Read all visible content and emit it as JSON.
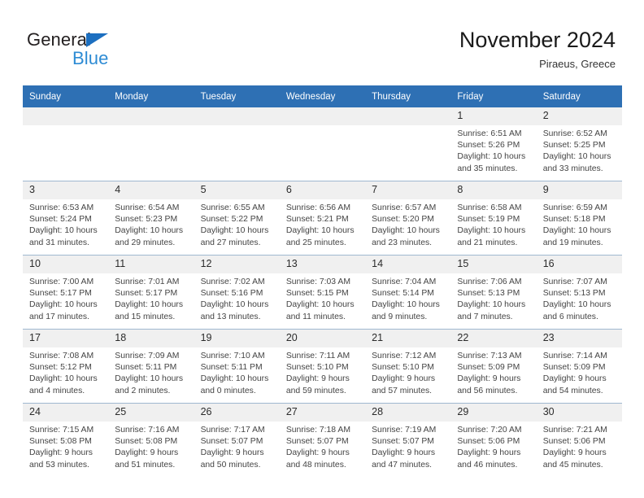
{
  "brand": {
    "name_part1": "General",
    "name_part2": "Blue",
    "triangle_icon": "triangle-icon",
    "accent_dark": "#231f20",
    "accent_blue": "#2d8bd4",
    "triangle_blue": "#1c6fc0"
  },
  "header": {
    "title": "November 2024",
    "subtitle": "Piraeus, Greece",
    "header_bg": "#2e70b4",
    "daynum_bg": "#f0f0f0"
  },
  "weekdays": [
    "Sunday",
    "Monday",
    "Tuesday",
    "Wednesday",
    "Thursday",
    "Friday",
    "Saturday"
  ],
  "weeks": [
    [
      {
        "day": "",
        "lines": []
      },
      {
        "day": "",
        "lines": []
      },
      {
        "day": "",
        "lines": []
      },
      {
        "day": "",
        "lines": []
      },
      {
        "day": "",
        "lines": []
      },
      {
        "day": "1",
        "lines": [
          "Sunrise: 6:51 AM",
          "Sunset: 5:26 PM",
          "Daylight: 10 hours",
          "and 35 minutes."
        ]
      },
      {
        "day": "2",
        "lines": [
          "Sunrise: 6:52 AM",
          "Sunset: 5:25 PM",
          "Daylight: 10 hours",
          "and 33 minutes."
        ]
      }
    ],
    [
      {
        "day": "3",
        "lines": [
          "Sunrise: 6:53 AM",
          "Sunset: 5:24 PM",
          "Daylight: 10 hours",
          "and 31 minutes."
        ]
      },
      {
        "day": "4",
        "lines": [
          "Sunrise: 6:54 AM",
          "Sunset: 5:23 PM",
          "Daylight: 10 hours",
          "and 29 minutes."
        ]
      },
      {
        "day": "5",
        "lines": [
          "Sunrise: 6:55 AM",
          "Sunset: 5:22 PM",
          "Daylight: 10 hours",
          "and 27 minutes."
        ]
      },
      {
        "day": "6",
        "lines": [
          "Sunrise: 6:56 AM",
          "Sunset: 5:21 PM",
          "Daylight: 10 hours",
          "and 25 minutes."
        ]
      },
      {
        "day": "7",
        "lines": [
          "Sunrise: 6:57 AM",
          "Sunset: 5:20 PM",
          "Daylight: 10 hours",
          "and 23 minutes."
        ]
      },
      {
        "day": "8",
        "lines": [
          "Sunrise: 6:58 AM",
          "Sunset: 5:19 PM",
          "Daylight: 10 hours",
          "and 21 minutes."
        ]
      },
      {
        "day": "9",
        "lines": [
          "Sunrise: 6:59 AM",
          "Sunset: 5:18 PM",
          "Daylight: 10 hours",
          "and 19 minutes."
        ]
      }
    ],
    [
      {
        "day": "10",
        "lines": [
          "Sunrise: 7:00 AM",
          "Sunset: 5:17 PM",
          "Daylight: 10 hours",
          "and 17 minutes."
        ]
      },
      {
        "day": "11",
        "lines": [
          "Sunrise: 7:01 AM",
          "Sunset: 5:17 PM",
          "Daylight: 10 hours",
          "and 15 minutes."
        ]
      },
      {
        "day": "12",
        "lines": [
          "Sunrise: 7:02 AM",
          "Sunset: 5:16 PM",
          "Daylight: 10 hours",
          "and 13 minutes."
        ]
      },
      {
        "day": "13",
        "lines": [
          "Sunrise: 7:03 AM",
          "Sunset: 5:15 PM",
          "Daylight: 10 hours",
          "and 11 minutes."
        ]
      },
      {
        "day": "14",
        "lines": [
          "Sunrise: 7:04 AM",
          "Sunset: 5:14 PM",
          "Daylight: 10 hours",
          "and 9 minutes."
        ]
      },
      {
        "day": "15",
        "lines": [
          "Sunrise: 7:06 AM",
          "Sunset: 5:13 PM",
          "Daylight: 10 hours",
          "and 7 minutes."
        ]
      },
      {
        "day": "16",
        "lines": [
          "Sunrise: 7:07 AM",
          "Sunset: 5:13 PM",
          "Daylight: 10 hours",
          "and 6 minutes."
        ]
      }
    ],
    [
      {
        "day": "17",
        "lines": [
          "Sunrise: 7:08 AM",
          "Sunset: 5:12 PM",
          "Daylight: 10 hours",
          "and 4 minutes."
        ]
      },
      {
        "day": "18",
        "lines": [
          "Sunrise: 7:09 AM",
          "Sunset: 5:11 PM",
          "Daylight: 10 hours",
          "and 2 minutes."
        ]
      },
      {
        "day": "19",
        "lines": [
          "Sunrise: 7:10 AM",
          "Sunset: 5:11 PM",
          "Daylight: 10 hours",
          "and 0 minutes."
        ]
      },
      {
        "day": "20",
        "lines": [
          "Sunrise: 7:11 AM",
          "Sunset: 5:10 PM",
          "Daylight: 9 hours",
          "and 59 minutes."
        ]
      },
      {
        "day": "21",
        "lines": [
          "Sunrise: 7:12 AM",
          "Sunset: 5:10 PM",
          "Daylight: 9 hours",
          "and 57 minutes."
        ]
      },
      {
        "day": "22",
        "lines": [
          "Sunrise: 7:13 AM",
          "Sunset: 5:09 PM",
          "Daylight: 9 hours",
          "and 56 minutes."
        ]
      },
      {
        "day": "23",
        "lines": [
          "Sunrise: 7:14 AM",
          "Sunset: 5:09 PM",
          "Daylight: 9 hours",
          "and 54 minutes."
        ]
      }
    ],
    [
      {
        "day": "24",
        "lines": [
          "Sunrise: 7:15 AM",
          "Sunset: 5:08 PM",
          "Daylight: 9 hours",
          "and 53 minutes."
        ]
      },
      {
        "day": "25",
        "lines": [
          "Sunrise: 7:16 AM",
          "Sunset: 5:08 PM",
          "Daylight: 9 hours",
          "and 51 minutes."
        ]
      },
      {
        "day": "26",
        "lines": [
          "Sunrise: 7:17 AM",
          "Sunset: 5:07 PM",
          "Daylight: 9 hours",
          "and 50 minutes."
        ]
      },
      {
        "day": "27",
        "lines": [
          "Sunrise: 7:18 AM",
          "Sunset: 5:07 PM",
          "Daylight: 9 hours",
          "and 48 minutes."
        ]
      },
      {
        "day": "28",
        "lines": [
          "Sunrise: 7:19 AM",
          "Sunset: 5:07 PM",
          "Daylight: 9 hours",
          "and 47 minutes."
        ]
      },
      {
        "day": "29",
        "lines": [
          "Sunrise: 7:20 AM",
          "Sunset: 5:06 PM",
          "Daylight: 9 hours",
          "and 46 minutes."
        ]
      },
      {
        "day": "30",
        "lines": [
          "Sunrise: 7:21 AM",
          "Sunset: 5:06 PM",
          "Daylight: 9 hours",
          "and 45 minutes."
        ]
      }
    ]
  ]
}
